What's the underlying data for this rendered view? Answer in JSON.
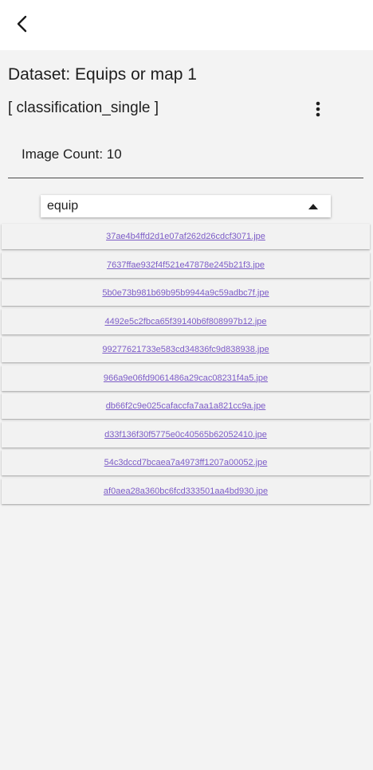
{
  "header": {
    "back_icon": "chevron-left-icon"
  },
  "dataset": {
    "title": "Dataset: Equips or map 1",
    "type": "[ classification_single ]",
    "more_icon": "more-vert-icon",
    "image_count": "Image Count: 10"
  },
  "filter": {
    "selected": "equip",
    "arrow_icon": "arrow-drop-up-icon"
  },
  "files": [
    "37ae4b4ffd2d1e07af262d26cdcf3071.jpe",
    "7637ffae932f4f521e47878e245b21f3.jpe",
    "5b0e73b981b69b95b9944a9c59adbc7f.jpe",
    "4492e5c2fbca65f39140b6f808997b12.jpe",
    "99277621733e583cd34836fc9d838938.jpe",
    "966a9e06fd9061486a29cac08231f4a5.jpe",
    "db66f2c9e025cafaccfa7aa1a821cc9a.jpe",
    "d33f136f30f5775e0c40565b62052410.jpe",
    "54c3dccd7bcaea7a4973ff1207a00052.jpe",
    "af0aea28a360bc6fcd333501aa4bd930.jpe"
  ],
  "colors": {
    "link": "#7c5cc7",
    "background": "#f3f3f3",
    "appbar": "#ffffff"
  }
}
